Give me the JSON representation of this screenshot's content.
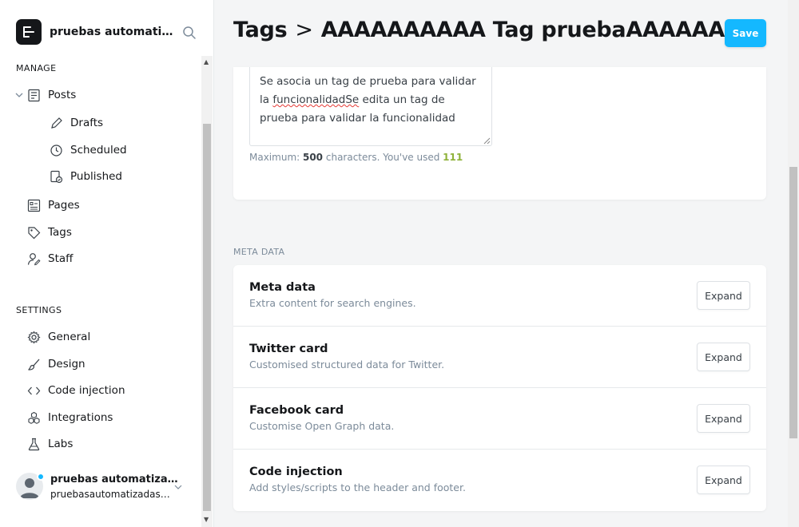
{
  "site": {
    "title": "pruebas automatiz..."
  },
  "sidebar": {
    "manage_heading": "MANAGE",
    "posts": "Posts",
    "drafts": "Drafts",
    "scheduled": "Scheduled",
    "published": "Published",
    "pages": "Pages",
    "tags": "Tags",
    "staff": "Staff",
    "settings_heading": "SETTINGS",
    "general": "General",
    "design": "Design",
    "code_injection": "Code injection",
    "integrations": "Integrations",
    "labs": "Labs"
  },
  "user": {
    "name": "pruebas automatizada...",
    "email": "pruebasautomatizadas@u..."
  },
  "header": {
    "crumb_root": "Tags",
    "separator": ">",
    "tag_name": "AAAAAAAAAA Tag pruebaAAAAAAAAAA",
    "save_label": "Save"
  },
  "description": {
    "text_part1": "Se asocia un tag de prueba para validar la ",
    "misspelled": "funcionalidadSe",
    "text_part2": " edita un tag de prueba para validar la funcionalidad",
    "hint_prefix": "Maximum: ",
    "max": "500",
    "hint_mid": " characters. You've used ",
    "used": "111"
  },
  "meta": {
    "section_label": "META DATA",
    "rows": [
      {
        "title": "Meta data",
        "subtitle": "Extra content for search engines.",
        "button": "Expand"
      },
      {
        "title": "Twitter card",
        "subtitle": "Customised structured data for Twitter.",
        "button": "Expand"
      },
      {
        "title": "Facebook card",
        "subtitle": "Customise Open Graph data.",
        "button": "Expand"
      },
      {
        "title": "Code injection",
        "subtitle": "Add styles/scripts to the header and footer.",
        "button": "Expand"
      }
    ]
  },
  "colors": {
    "accent": "#14b8ff",
    "count_ok": "#8fb23a",
    "muted": "#7c8b9a"
  }
}
